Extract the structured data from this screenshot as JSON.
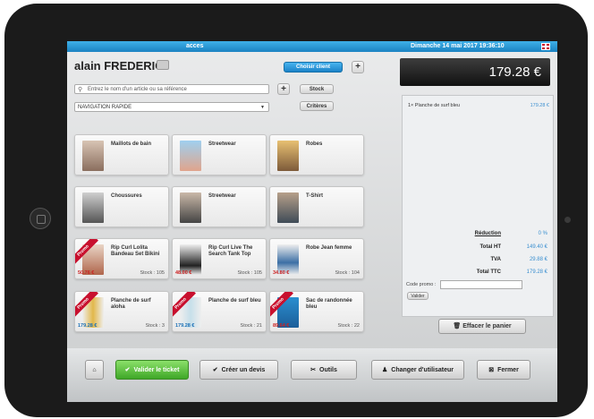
{
  "topbar": {
    "title": "acces",
    "datetime": "Dimanche 14 mai 2017   19:36:10",
    "flag_icon": "uk-flag-icon"
  },
  "client": {
    "name": "alain FREDERIC",
    "choose_label": "Choisir client",
    "plus": "+"
  },
  "search": {
    "placeholder": "Entrez le nom d'un article ou sa référence",
    "plus": "+",
    "stock_label": "Stock"
  },
  "navigation": {
    "selected": "NAVIGATION RAPIDE",
    "criteres_label": "Critères"
  },
  "categories": [
    {
      "name": "Maillots de bain"
    },
    {
      "name": "Streetwear"
    },
    {
      "name": "Robes"
    },
    {
      "name": "Choussures"
    },
    {
      "name": "Streetwear"
    },
    {
      "name": "T-Shirt"
    }
  ],
  "products": [
    {
      "name": "Rip Curl Lolita Bandeau Set Bikini",
      "price": "50.76 €",
      "stock": "Stock : 105",
      "promo": "Promo"
    },
    {
      "name": "Rip Curl Live The Search Tank Top",
      "price": "48.00 €",
      "stock": "Stock : 105",
      "promo": ""
    },
    {
      "name": "Robe Jean femme",
      "price": "34.80 €",
      "stock": "Stock : 104",
      "promo": ""
    },
    {
      "name": "Planche de surf aloha",
      "price": "179.28 €",
      "stock": "Stock : 3",
      "promo": "Promo"
    },
    {
      "name": "Planche de surf bleu",
      "price": "179.28 €",
      "stock": "Stock : 21",
      "promo": "Promo"
    },
    {
      "name": "Sac de randonnée bleu",
      "price": "89.64 €",
      "stock": "Stock : 22",
      "promo": "Promo"
    }
  ],
  "ticket": {
    "total_display": "179.28 €",
    "line_item": "1× Planche de surf bleu",
    "line_price": "179.28 €",
    "reduction_label": "Réduction",
    "reduction_value": "0 %",
    "total_ht_label": "Total HT",
    "total_ht_value": "149.40 €",
    "tva_label": "TVA",
    "tva_value": "29.88 €",
    "total_ttc_label": "Total TTC",
    "total_ttc_value": "179.28 €",
    "promo_code_label": "Code promo :",
    "valider_label": "Valider",
    "effacer_label": "Effacer le panier"
  },
  "actions": {
    "valider_ticket": "Valider le ticket",
    "creer_devis": "Créer un devis",
    "outils": "Outils",
    "changer_utilisateur": "Changer d'utilisateur",
    "fermer": "Fermer"
  }
}
